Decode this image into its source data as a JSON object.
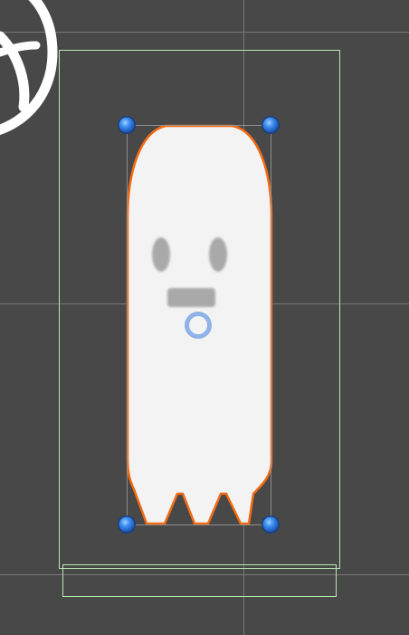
{
  "scene_view": {
    "background_color": "#484848",
    "grid_color": "#8a8a8a",
    "collider_color": "#b9e7b4",
    "outline_color": "#f26a13",
    "handle_color": "#2f7fe6",
    "pivot_color": "#8fb2e8",
    "ghost_color": "#f3f3f3",
    "ghost_feature_color": "#a9a9a9",
    "icons": {
      "partial_gizmo": "web-wheel-icon",
      "pivot": "pivot-ring-icon",
      "resize_handle": "resize-handle-icon"
    }
  }
}
